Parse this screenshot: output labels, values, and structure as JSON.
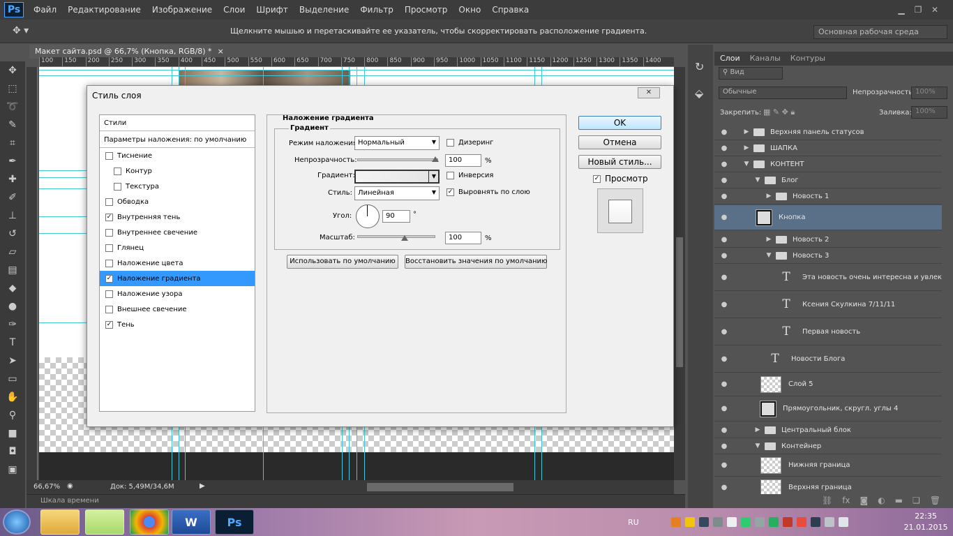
{
  "menubar": {
    "logo": "Ps",
    "items": [
      "Файл",
      "Редактирование",
      "Изображение",
      "Слои",
      "Шрифт",
      "Выделение",
      "Фильтр",
      "Просмотр",
      "Окно",
      "Справка"
    ]
  },
  "options": {
    "hint": "Щелкните мышью и перетаскивайте ее указатель, чтобы скорректировать расположение градиента.",
    "workspace": "Основная рабочая среда"
  },
  "document": {
    "tab_title": "Макет сайта.psd @ 66,7% (Кнопка, RGB/8) *",
    "tab_close": "×",
    "ruler_marks": [
      "100",
      "150",
      "200",
      "250",
      "300",
      "350",
      "400",
      "450",
      "500",
      "550",
      "600",
      "650",
      "700",
      "750",
      "800",
      "850",
      "900",
      "950",
      "1000",
      "1050",
      "1100",
      "1150",
      "1200",
      "1250",
      "1300",
      "1350",
      "1400"
    ],
    "zoom": "66,67%",
    "doc_info": "Док: 5,49M/34,6M",
    "timeline": "Шкала времени"
  },
  "dialog": {
    "title": "Стиль слоя",
    "styles_header": "Стили",
    "blend_defaults": "Параметры наложения: по умолчанию",
    "items": [
      {
        "label": "Тиснение",
        "checked": false
      },
      {
        "label": "Контур",
        "checked": false
      },
      {
        "label": "Текстура",
        "checked": false
      },
      {
        "label": "Обводка",
        "checked": false
      },
      {
        "label": "Внутренняя тень",
        "checked": true
      },
      {
        "label": "Внутреннее свечение",
        "checked": false
      },
      {
        "label": "Глянец",
        "checked": false
      },
      {
        "label": "Наложение цвета",
        "checked": false
      },
      {
        "label": "Наложение градиента",
        "checked": true
      },
      {
        "label": "Наложение узора",
        "checked": false
      },
      {
        "label": "Внешнее свечение",
        "checked": false
      },
      {
        "label": "Тень",
        "checked": true
      }
    ],
    "section_title": "Наложение градиента",
    "group_title": "Градиент",
    "blend_mode_label": "Режим наложения:",
    "blend_mode_value": "Нормальный",
    "dither_label": "Дизеринг",
    "opacity_label": "Непрозрачность:",
    "opacity_value": "100",
    "percent": "%",
    "gradient_label": "Градиент:",
    "reverse_label": "Инверсия",
    "style_label": "Стиль:",
    "style_value": "Линейная",
    "align_label": "Выровнять по слою",
    "angle_label": "Угол:",
    "angle_value": "90",
    "degree": "°",
    "scale_label": "Масштаб:",
    "scale_value": "100",
    "make_default": "Использовать по умолчанию",
    "reset_default": "Восстановить значения по умолчанию",
    "ok": "OK",
    "cancel": "Отмена",
    "new_style": "Новый стиль...",
    "preview_label": "Просмотр",
    "check_mark": "✓"
  },
  "layers_panel": {
    "tabs": [
      "Слои",
      "Каналы",
      "Контуры"
    ],
    "filter_label": "Вид",
    "blend_mode": "Обычные",
    "opacity_label": "Непрозрачность:",
    "opacity_value": "100%",
    "lock_label": "Закрепить:",
    "fill_label": "Заливка:",
    "fill_value": "100%",
    "eye_icon": "●",
    "layers": [
      {
        "name": "Верхняя панель статусов",
        "type": "folder",
        "arrow": "▶"
      },
      {
        "name": "ШАПКА",
        "type": "folder",
        "arrow": "▶"
      },
      {
        "name": "КОНТЕНТ",
        "type": "folder",
        "arrow": "▼"
      },
      {
        "name": "Блог",
        "type": "folder",
        "arrow": "▼"
      },
      {
        "name": "Новость 1",
        "type": "folder",
        "arrow": "▶"
      },
      {
        "name": "Кнопка",
        "type": "shape",
        "arrow": ""
      },
      {
        "name": "Новость 2",
        "type": "folder",
        "arrow": "▶"
      },
      {
        "name": "Новость 3",
        "type": "folder",
        "arrow": "▼"
      },
      {
        "name": "Эта новость очень интересна и увлек...",
        "type": "text",
        "arrow": ""
      },
      {
        "name": "Ксения Скулкина   7/11/11",
        "type": "text",
        "arrow": ""
      },
      {
        "name": "Первая новость",
        "type": "text",
        "arrow": ""
      },
      {
        "name": "Новости Блога",
        "type": "text",
        "arrow": ""
      },
      {
        "name": "Слой 5",
        "type": "pixel",
        "arrow": ""
      },
      {
        "name": "Прямоугольник, скругл. углы 4",
        "type": "shape",
        "arrow": ""
      },
      {
        "name": "Центральный блок",
        "type": "folder",
        "arrow": "▶"
      },
      {
        "name": "Контейнер",
        "type": "folder",
        "arrow": "▼"
      },
      {
        "name": "Нижняя граница",
        "type": "pixel",
        "arrow": ""
      },
      {
        "name": "Верхняя граница",
        "type": "pixel",
        "arrow": ""
      }
    ],
    "text_glyph": "T"
  },
  "taskbar": {
    "apps": [
      "",
      "",
      "",
      "W",
      "Ps"
    ],
    "lang": "RU",
    "time": "22:35",
    "date": "21.01.2015"
  }
}
